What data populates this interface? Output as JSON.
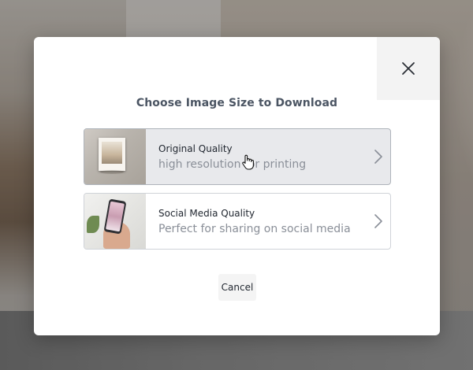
{
  "dialog": {
    "title": "Choose Image Size to Download",
    "close_icon": "close-icon",
    "options": [
      {
        "name": "Original Quality",
        "description": "high resolution for printing",
        "thumbnail": "framed-print-thumbnail",
        "selected": true
      },
      {
        "name": "Social Media Quality",
        "description": "Perfect for sharing on social media",
        "thumbnail": "phone-in-hand-thumbnail",
        "selected": false
      }
    ],
    "cancel_label": "Cancel"
  },
  "colors": {
    "title": "#4b5563",
    "selected_option_bg": "#e8e9ec",
    "option_border": "#cfd3d8",
    "description": "#8a8f98"
  }
}
